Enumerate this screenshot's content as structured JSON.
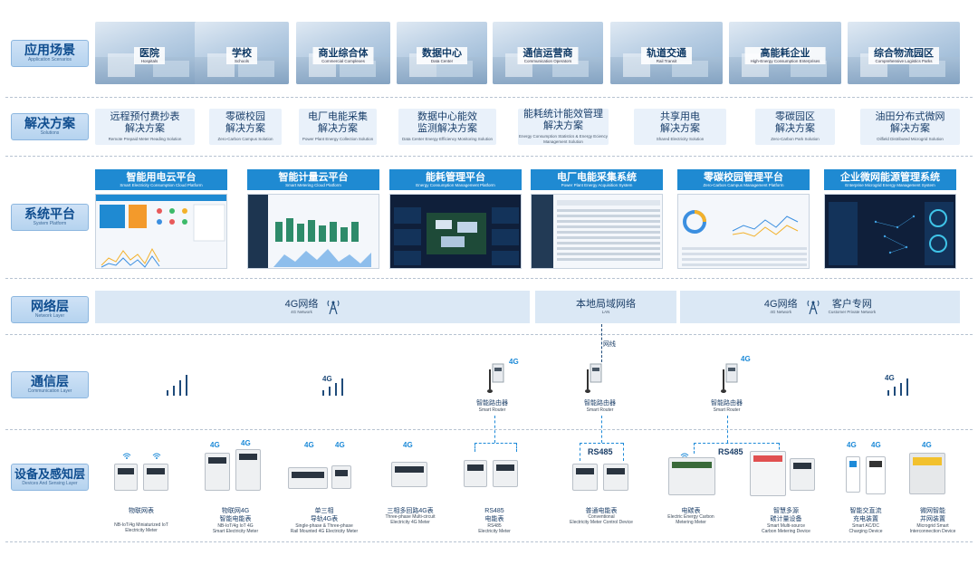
{
  "layers": [
    {
      "cn": "应用场景",
      "en": "Application Scenarios"
    },
    {
      "cn": "解决方案",
      "en": "Solutions"
    },
    {
      "cn": "系统平台",
      "en": "System Platform"
    },
    {
      "cn": "网络层",
      "en": "Network Layer"
    },
    {
      "cn": "通信层",
      "en": "Communication Layer"
    },
    {
      "cn": "设备及感知层",
      "en": "Devices And Sensing Layer"
    }
  ],
  "scenarios": [
    {
      "cn": "医院",
      "en": "Hospitals"
    },
    {
      "cn": "学校",
      "en": "Schools"
    },
    {
      "cn": "商业综合体",
      "en": "Commercial Complexes"
    },
    {
      "cn": "数据中心",
      "en": "Data Center"
    },
    {
      "cn": "通信运营商",
      "en": "Communication Operators"
    },
    {
      "cn": "轨道交通",
      "en": "Rail Transit"
    },
    {
      "cn": "高能耗企业",
      "en": "High-Energy Consumption Enterprises"
    },
    {
      "cn": "综合物流园区",
      "en": "Comprehensive Logistics Parks"
    }
  ],
  "solutions": [
    {
      "l1": "远程预付费抄表",
      "l2": "解决方案",
      "en": "Remote Prepaid Meter Reading Solution"
    },
    {
      "l1": "零碳校园",
      "l2": "解决方案",
      "en": "Zero-Carbon Campus Solution"
    },
    {
      "l1": "电厂电能采集",
      "l2": "解决方案",
      "en": "Power Plant Energy Collection Solution"
    },
    {
      "l1": "数据中心能效",
      "l2": "监测解决方案",
      "en": "Data Center Energy Efficiency Monitoring Solution"
    },
    {
      "l1": "能耗统计能效管理",
      "l2": "解决方案",
      "en": "Energy Consumption Statistics & Energy Eciency Management Solution"
    },
    {
      "l1": "共享用电",
      "l2": "解决方案",
      "en": "Shared Electricity Solution"
    },
    {
      "l1": "零碳园区",
      "l2": "解决方案",
      "en": "Zero-Carbon Park Solution"
    },
    {
      "l1": "油田分布式微网",
      "l2": "解决方案",
      "en": "Oilfield Distributed Microgrid Solution"
    }
  ],
  "platforms": [
    {
      "cn": "智能用电云平台",
      "en": "Smart Electricity Consumption Cloud Platform",
      "theme": "light"
    },
    {
      "cn": "智能计量云平台",
      "en": "Smart Metering Cloud Platform",
      "theme": "light"
    },
    {
      "cn": "能耗管理平台",
      "en": "Energy Consumption Management Platform",
      "theme": "dark"
    },
    {
      "cn": "电厂电能采集系统",
      "en": "Power Plant Energy Acquisition System",
      "theme": "light"
    },
    {
      "cn": "零碳校园管理平台",
      "en": "Zero-Carbon Campus Management Platform",
      "theme": "light"
    },
    {
      "cn": "企业微网能源管理系统",
      "en": "Enterprise Microgrid Energy Management System",
      "theme": "dark"
    }
  ],
  "network": {
    "n4g_left": {
      "cn": "4G网络",
      "en": "4G Network"
    },
    "lan": {
      "cn": "本地局域网络",
      "en": "LAN"
    },
    "n4g_right": {
      "cn": "4G网络",
      "en": "4G Network"
    },
    "private": {
      "cn": "客户专网",
      "en": "Customer Private Network"
    },
    "wired": "网线"
  },
  "communication": {
    "g4": "4G",
    "router": {
      "cn": "智能路由器",
      "en": "Smart Router"
    },
    "rs485": "RS485"
  },
  "devices": [
    {
      "cn1": "物联网表",
      "cn2": "",
      "en1": "NB-IoT/4g Miniaturized IoT",
      "en2": "Electricity Meter"
    },
    {
      "cn1": "物联网4G",
      "cn2": "智能电能表",
      "en1": "NB-IoT/4g IoT 4G",
      "en2": "Smart Electricity Meter"
    },
    {
      "cn1": "单三相",
      "cn2": "导轨4G表",
      "en1": "Single-phase & Three-phase",
      "en2": "Rail Mounted 4G Electricity Meter"
    },
    {
      "cn1": "三相多回路4G表",
      "cn2": "",
      "en1": "Three-phase Multi-circuit",
      "en2": "Electricity 4G Meter"
    },
    {
      "cn1": "RS485",
      "cn2": "电能表",
      "en1": "RS485",
      "en2": "Electricity Meter"
    },
    {
      "cn1": "普通电能表",
      "cn2": "",
      "en1": "Conventional",
      "en2": "Electricity Meter Control Device"
    },
    {
      "cn1": "电碳表",
      "cn2": "",
      "en1": "Electric Energy Carbon",
      "en2": "Metering Meter"
    },
    {
      "cn1": "智慧多源",
      "cn2": "碳计量设备",
      "en1": "Smart Multi-source",
      "en2": "Carbon Metering Device"
    },
    {
      "cn1": "智能交直流",
      "cn2": "充电装置",
      "en1": "Smart AC/DC",
      "en2": "Charging Device"
    },
    {
      "cn1": "微网智能",
      "cn2": "并网装置",
      "en1": "Microgrid Smart",
      "en2": "Interconnection Device"
    }
  ],
  "colors": {
    "accent": "#1f8ad2",
    "label_bg": "#c4dcf2",
    "net_bg": "#dbe8f5"
  }
}
